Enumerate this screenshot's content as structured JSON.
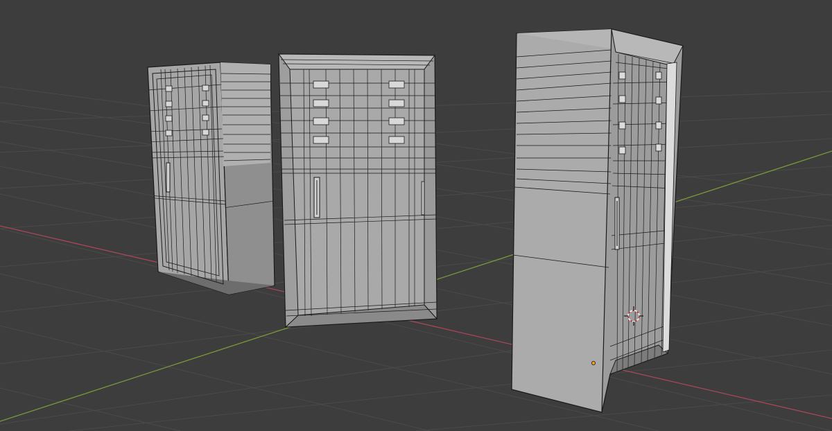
{
  "viewport": {
    "background": "#3d3d3d",
    "grid_color": "#4a4a4a",
    "x_axis_color": "#a8475a",
    "y_axis_color": "#7a9a3c",
    "wire_color": "#1a1a1a",
    "face_light": "#a9a9a9",
    "face_mid": "#9a9a9a",
    "face_dark": "#8c8c8c",
    "cursor_color": "#c23b3b",
    "origin_color": "#f0a020"
  },
  "objects": [
    {
      "id": "left-cabinet",
      "selected": false
    },
    {
      "id": "middle-cabinet",
      "selected": false
    },
    {
      "id": "right-cabinet",
      "selected": false
    }
  ]
}
